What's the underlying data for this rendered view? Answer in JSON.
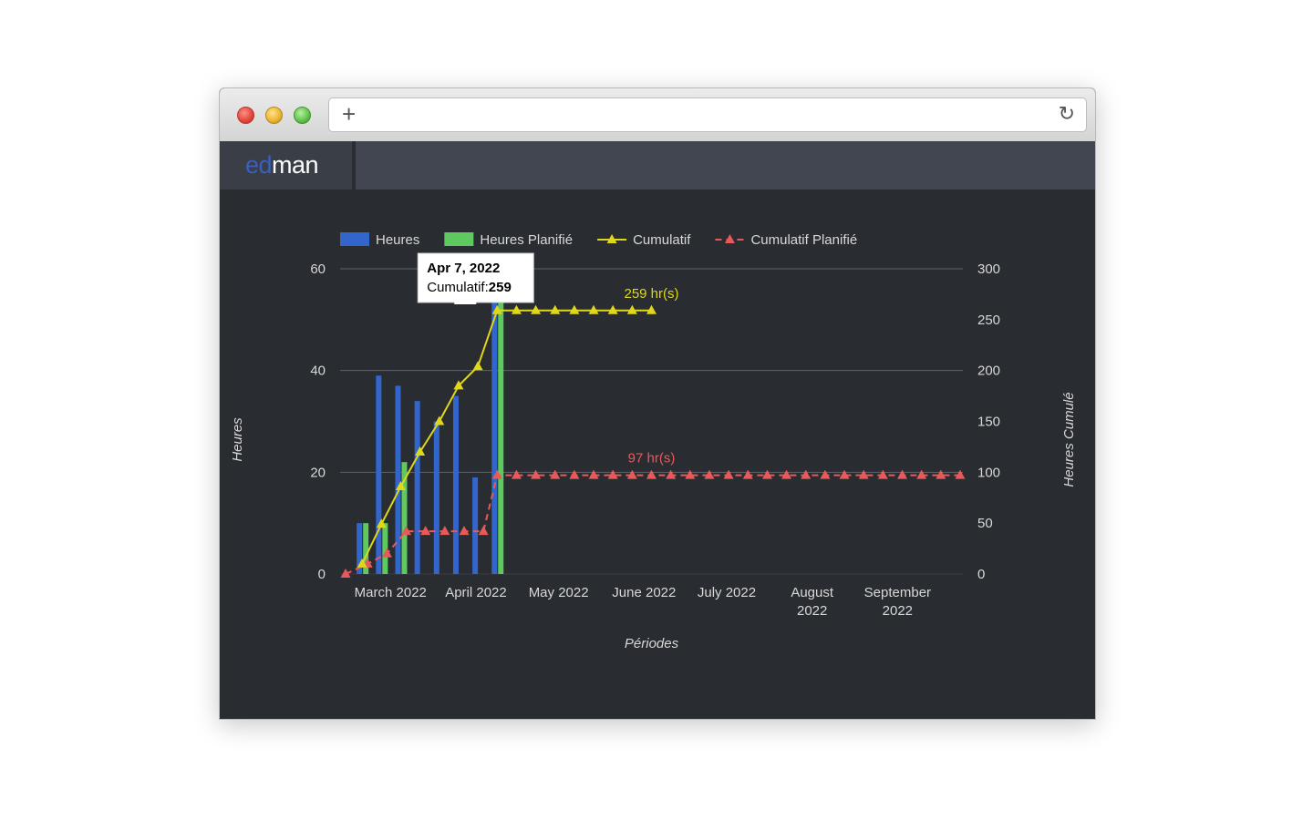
{
  "browser": {
    "new_tab_glyph": "+",
    "reload_glyph": "↻",
    "url": ""
  },
  "app": {
    "logo_part1": "ed",
    "logo_part2": "man",
    "logo_colors": {
      "primary": "#3a5fc0",
      "secondary": "#ffffff"
    }
  },
  "chart_data": {
    "type": "bar+line",
    "legend": [
      {
        "name": "Heures",
        "kind": "bar",
        "color": "#3366cc"
      },
      {
        "name": "Heures Planifié",
        "kind": "bar",
        "color": "#5ec95e"
      },
      {
        "name": "Cumulatif",
        "kind": "line",
        "color": "#e0d71a"
      },
      {
        "name": "Cumulatif Planifié",
        "kind": "dashed-line",
        "color": "#e85a5a"
      }
    ],
    "legend_position": "top",
    "ylabel_left": "Heures",
    "ylabel_right": "Heures Cumulé",
    "xlabel": "Périodes",
    "y_left": {
      "min": 0,
      "max": 60,
      "ticks": [
        0,
        20,
        40,
        60
      ]
    },
    "y_right": {
      "min": 0,
      "max": 300,
      "ticks": [
        0,
        50,
        100,
        150,
        200,
        250,
        300
      ]
    },
    "x_domain": [
      "2022-02-16",
      "2022-09-30"
    ],
    "x_ticks": [
      {
        "date": "2022-03-01",
        "label": [
          "March 2022"
        ]
      },
      {
        "date": "2022-04-01",
        "label": [
          "April 2022"
        ]
      },
      {
        "date": "2022-05-01",
        "label": [
          "May 2022"
        ]
      },
      {
        "date": "2022-06-01",
        "label": [
          "June 2022"
        ]
      },
      {
        "date": "2022-07-01",
        "label": [
          "July 2022"
        ]
      },
      {
        "date": "2022-08-01",
        "label": [
          "August",
          "2022"
        ]
      },
      {
        "date": "2022-09-01",
        "label": [
          "September",
          "2022"
        ]
      }
    ],
    "grid": true,
    "heures": [
      {
        "date": "2022-02-24",
        "value": 10
      },
      {
        "date": "2022-03-03",
        "value": 39
      },
      {
        "date": "2022-03-10",
        "value": 37
      },
      {
        "date": "2022-03-17",
        "value": 34
      },
      {
        "date": "2022-03-24",
        "value": 30
      },
      {
        "date": "2022-03-31",
        "value": 35
      },
      {
        "date": "2022-04-07",
        "value": 19
      },
      {
        "date": "2022-04-14",
        "value": 55
      }
    ],
    "heures_planifie": [
      {
        "date": "2022-02-24",
        "value": 10
      },
      {
        "date": "2022-03-03",
        "value": 10
      },
      {
        "date": "2022-03-10",
        "value": 22
      },
      {
        "date": "2022-04-14",
        "value": 55
      }
    ],
    "cumulatif": [
      {
        "date": "2022-02-24",
        "value": 10
      },
      {
        "date": "2022-03-03",
        "value": 49
      },
      {
        "date": "2022-03-10",
        "value": 86
      },
      {
        "date": "2022-03-17",
        "value": 120
      },
      {
        "date": "2022-03-24",
        "value": 150
      },
      {
        "date": "2022-03-31",
        "value": 185
      },
      {
        "date": "2022-04-07",
        "value": 204
      },
      {
        "date": "2022-04-14",
        "value": 259
      },
      {
        "date": "2022-04-21",
        "value": 259
      },
      {
        "date": "2022-04-28",
        "value": 259
      },
      {
        "date": "2022-05-05",
        "value": 259
      },
      {
        "date": "2022-05-12",
        "value": 259
      },
      {
        "date": "2022-05-19",
        "value": 259
      },
      {
        "date": "2022-05-26",
        "value": 259
      },
      {
        "date": "2022-06-02",
        "value": 259
      },
      {
        "date": "2022-06-09",
        "value": 259
      }
    ],
    "cumulatif_planifie": [
      {
        "date": "2022-02-18",
        "value": 0
      },
      {
        "date": "2022-02-26",
        "value": 10
      },
      {
        "date": "2022-03-05",
        "value": 20
      },
      {
        "date": "2022-03-12",
        "value": 42
      },
      {
        "date": "2022-03-19",
        "value": 42
      },
      {
        "date": "2022-03-26",
        "value": 42
      },
      {
        "date": "2022-04-02",
        "value": 42
      },
      {
        "date": "2022-04-09",
        "value": 42
      },
      {
        "date": "2022-04-14",
        "value": 97
      },
      {
        "date": "2022-04-21",
        "value": 97
      },
      {
        "date": "2022-04-28",
        "value": 97
      },
      {
        "date": "2022-05-05",
        "value": 97
      },
      {
        "date": "2022-05-12",
        "value": 97
      },
      {
        "date": "2022-05-19",
        "value": 97
      },
      {
        "date": "2022-05-26",
        "value": 97
      },
      {
        "date": "2022-06-02",
        "value": 97
      },
      {
        "date": "2022-06-09",
        "value": 97
      },
      {
        "date": "2022-06-16",
        "value": 97
      },
      {
        "date": "2022-06-23",
        "value": 97
      },
      {
        "date": "2022-06-30",
        "value": 97
      },
      {
        "date": "2022-07-07",
        "value": 97
      },
      {
        "date": "2022-07-14",
        "value": 97
      },
      {
        "date": "2022-07-21",
        "value": 97
      },
      {
        "date": "2022-07-28",
        "value": 97
      },
      {
        "date": "2022-08-04",
        "value": 97
      },
      {
        "date": "2022-08-11",
        "value": 97
      },
      {
        "date": "2022-08-18",
        "value": 97
      },
      {
        "date": "2022-08-25",
        "value": 97
      },
      {
        "date": "2022-09-01",
        "value": 97
      },
      {
        "date": "2022-09-08",
        "value": 97
      },
      {
        "date": "2022-09-15",
        "value": 97
      },
      {
        "date": "2022-09-22",
        "value": 97
      },
      {
        "date": "2022-09-29",
        "value": 97
      }
    ],
    "annotations": [
      {
        "series": "Cumulatif",
        "date": "2022-06-09",
        "value": 259,
        "text": "259 hr(s)",
        "color": "#e0d71a"
      },
      {
        "series": "Cumulatif Planifié",
        "date": "2022-06-09",
        "value": 97,
        "text": "97 hr(s)",
        "color": "#e85a5a"
      }
    ],
    "tooltip": {
      "title": "Apr 7, 2022",
      "label": "Cumulatif: ",
      "value": "259",
      "anchor_date": "2022-04-14",
      "anchor_value": 259
    }
  }
}
